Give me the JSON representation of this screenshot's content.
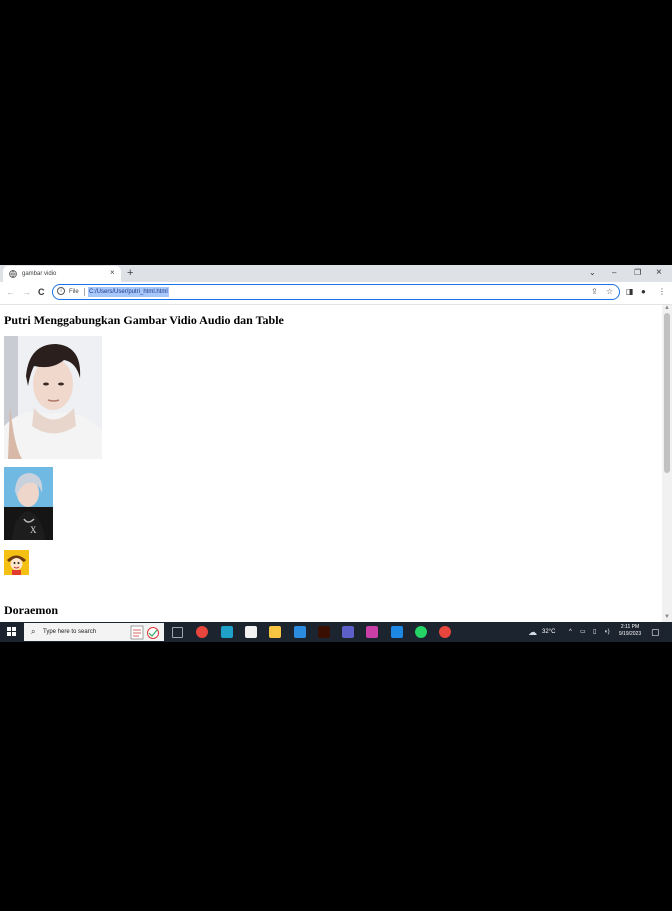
{
  "browser": {
    "tab_title": "gambar vidio",
    "tab_close": "×",
    "new_tab": "+",
    "window_controls": {
      "menu": "⌄",
      "minimize": "–",
      "restore": "❐",
      "close": "×"
    },
    "omnibox": {
      "scheme_label": "File",
      "url": "C:/Users/User/putri_html.html"
    },
    "nav": {
      "back": "←",
      "forward": "→",
      "reload": "C"
    }
  },
  "page": {
    "heading": "Putri Menggabungkan Gambar Vidio Audio dan Table",
    "subheading": "Doraemon",
    "images": [
      {
        "name": "photo-portrait-large"
      },
      {
        "name": "photo-portrait-small"
      },
      {
        "name": "doraemon-icon-image"
      }
    ]
  },
  "taskbar": {
    "search_placeholder": "Type here to search",
    "weather": "32°C",
    "time": "2:11 PM",
    "date": "9/19/2023",
    "apps": [
      {
        "name": "task-view-icon",
        "color": "#3a3f4a"
      },
      {
        "name": "chrome-icon",
        "color": "#e8453c"
      },
      {
        "name": "edge-icon",
        "color": "#1fa0c8"
      },
      {
        "name": "store-icon",
        "color": "#f2f2f2"
      },
      {
        "name": "file-explorer-icon",
        "color": "#f5c542"
      },
      {
        "name": "mail-icon",
        "color": "#2b8ce0"
      },
      {
        "name": "illustrator-icon",
        "color": "#3a0e00"
      },
      {
        "name": "app-purple-icon",
        "color": "#5b5fc7"
      },
      {
        "name": "app-pink-icon",
        "color": "#c83fa8"
      },
      {
        "name": "vscode-icon",
        "color": "#1e88e5"
      },
      {
        "name": "whatsapp-icon",
        "color": "#25d366"
      },
      {
        "name": "chrome-active-icon",
        "color": "#e8453c"
      }
    ]
  }
}
